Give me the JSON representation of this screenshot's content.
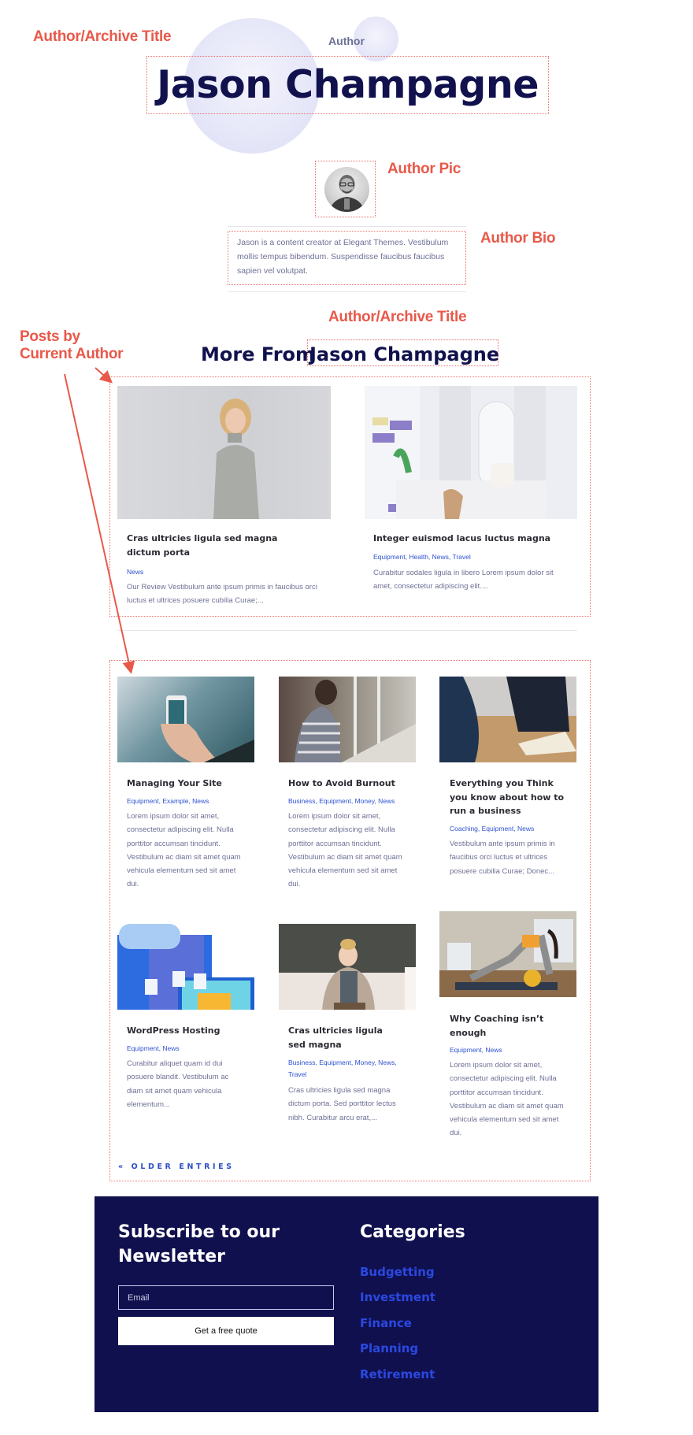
{
  "annotations": {
    "author_archive_title_top": "Author/Archive Title",
    "author_pic": "Author Pic",
    "author_bio": "Author Bio",
    "author_archive_title_mid": "Author/Archive Title",
    "posts_by_line1": "Posts by",
    "posts_by_line2": "Current Author"
  },
  "header": {
    "eyebrow": "Author",
    "title": "Jason Champagne"
  },
  "author": {
    "avatar_alt": "Jason Champagne avatar",
    "bio": "Jason is a content creator at Elegant Themes. Vestibulum mollis tempus bibendum. Suspendisse faucibus faucibus sapien vel volutpat."
  },
  "more_from": {
    "prefix": "More From",
    "name": "Jason Champagne"
  },
  "featured_posts": [
    {
      "image": "woman-grey-sweater-photo",
      "title": "Cras ultricies ligula sed magna dictum porta",
      "tags": "News",
      "excerpt": "Our Review Vestibulum ante ipsum primis in faucibus orci luctus et ultrices posuere cubilia Curae;..."
    },
    {
      "image": "bright-dining-room-photo",
      "title": "Integer euismod lacus luctus magna",
      "tags": "Equipment, Health, News, Travel",
      "excerpt": "Curabitur sodales ligula in libero Lorem ipsum dolor sit amet, consectetur adipiscing elit...."
    }
  ],
  "grid_posts": [
    {
      "image": "hand-holding-phone-photo",
      "title": "Managing Your Site",
      "tags": "Equipment, Example, News",
      "excerpt": "Lorem ipsum dolor sit amet, consectetur adipiscing elit. Nulla porttitor accumsan tincidunt. Vestibulum ac diam sit amet quam vehicula elementum sed sit amet dui."
    },
    {
      "image": "woman-by-window-photo",
      "title": "How to Avoid Burnout",
      "tags": "Business, Equipment, Money, News",
      "excerpt": "Lorem ipsum dolor sit amet, consectetur adipiscing elit. Nulla porttitor accumsan tincidunt. Vestibulum ac diam sit amet quam vehicula elementum sed sit amet dui."
    },
    {
      "image": "business-meeting-book-photo",
      "title": "Everything you Think you know about how to run a business",
      "tags": "Coaching, Equipment, News",
      "excerpt": "Vestibulum ante ipsum primis in faucibus orci luctus et ultrices posuere cubilia Curae; Donec..."
    },
    {
      "image": "hosting-illustration",
      "title": "WordPress Hosting",
      "tags": "Equipment, News",
      "excerpt": "Curabitur aliquet quam id dui posuere blandit. Vestibulum ac diam sit amet quam vehicula elementum..."
    },
    {
      "image": "woman-laughing-laptop-photo",
      "title": "Cras ultricies ligula sed magna",
      "tags": "Business, Equipment, Money, News, Travel",
      "excerpt": "Cras ultricies ligula sed magna dictum porta. Sed porttitor lectus nibh. Curabitur arcu erat,..."
    },
    {
      "image": "woman-workout-gym-photo",
      "title": "Why Coaching isn’t enough",
      "tags": "Equipment, News",
      "excerpt": "Lorem ipsum dolor sit amet, consectetur adipiscing elit. Nulla porttitor accumsan tincidunt. Vestibulum ac diam sit amet quam vehicula elementum sed sit amet dui."
    }
  ],
  "pagination": {
    "older_entries": "« OLDER ENTRIES"
  },
  "footer": {
    "newsletter_title": "Subscribe to our Newsletter",
    "email_placeholder": "Email",
    "email_value": "",
    "button_label": "Get a free quote",
    "categories_title": "Categories",
    "categories": [
      "Budgetting",
      "Investment",
      "Finance",
      "Planning",
      "Retirement"
    ]
  },
  "colors": {
    "annotation": "#e8594a",
    "navy": "#11114e",
    "footer_bg": "#10104f",
    "link_blue": "#2b48e0",
    "tag_blue": "#2e52d0",
    "body_text": "#6e7096"
  }
}
